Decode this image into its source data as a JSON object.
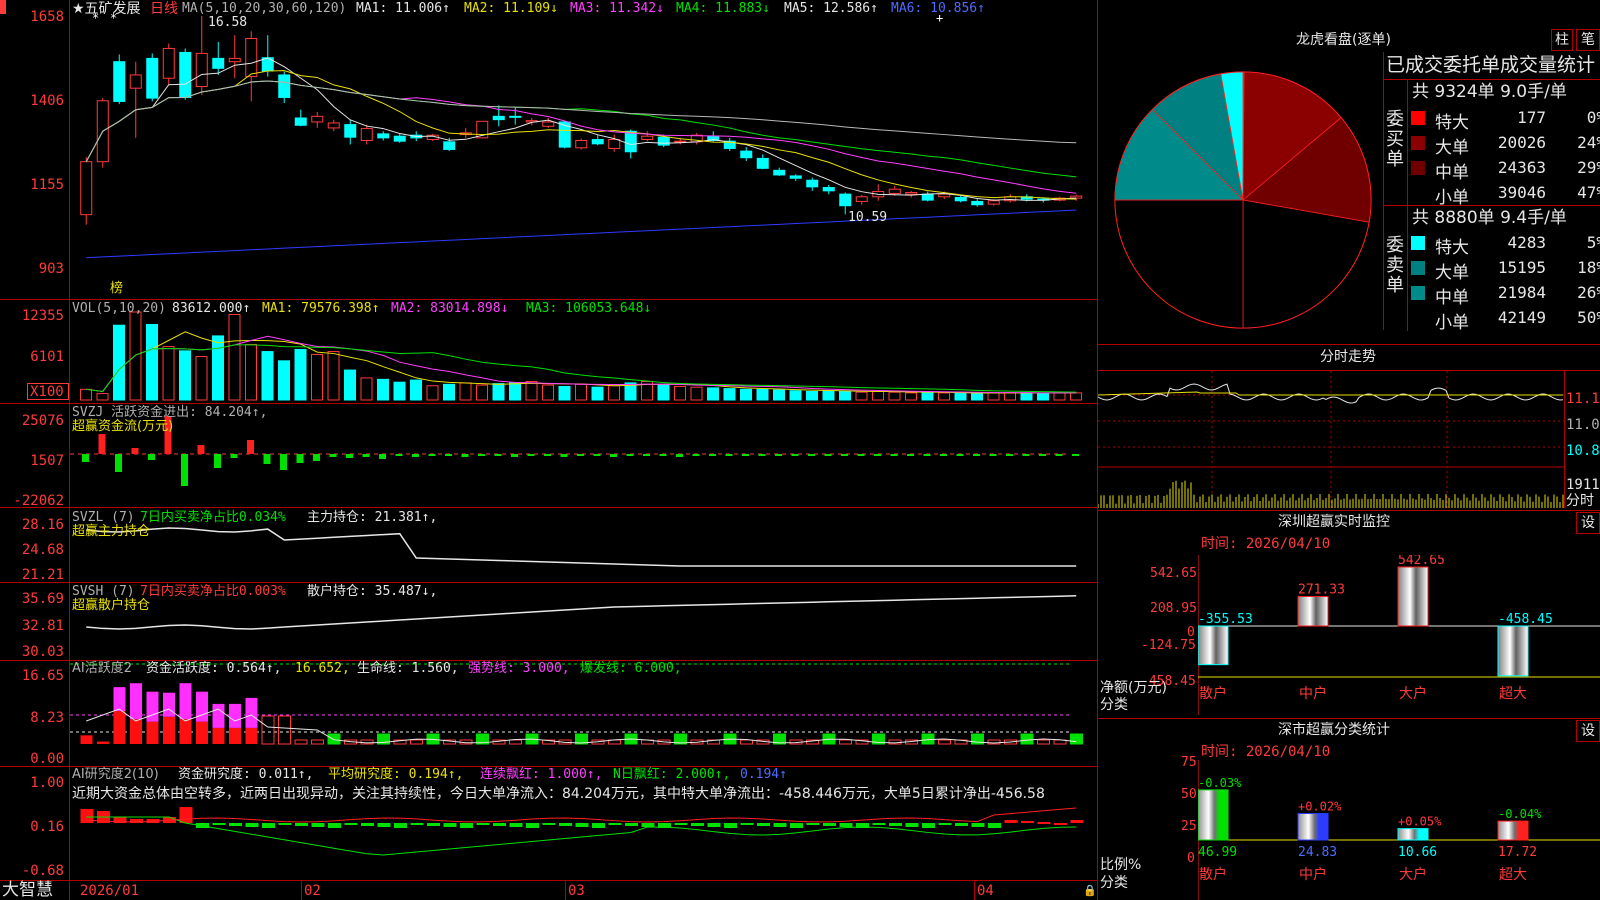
{
  "main_chart": {
    "title": "★五矿发展",
    "period": "日线",
    "ma_label": "MA(5,10,20,30,60,120)",
    "ma1": "MA1: 11.006↑",
    "ma2": "MA2: 11.109↓",
    "ma3": "MA3: 11.342↓",
    "ma4": "MA4: 11.883↓",
    "ma5": "MA5: 12.586↑",
    "ma6": "MA6: 10.856↑",
    "high_label": "16.58",
    "low_label": "10.59",
    "bang_label": "榜",
    "y_ticks": [
      "1658",
      "1406",
      "1155",
      "903"
    ]
  },
  "vol_panel": {
    "label": "VOL(5,10,20)",
    "vol": "83612.000↑",
    "ma1": "MA1: 79576.398↑",
    "ma2": "MA2: 83014.898↓",
    "ma3": "MA3: 106053.648↓",
    "y_ticks": [
      "12355",
      "6101"
    ],
    "unit": "X100"
  },
  "svzj_panel": {
    "line1": "SVZJ  活跃资金进出: 84.204↑,",
    "line2": "超赢资金流(万元)",
    "y_ticks": [
      "25076",
      "1507",
      "-22062"
    ]
  },
  "svzl_panel": {
    "prefix": "SVZL (7)",
    "ratio": "7日内买卖净占比0.034%",
    "hold": "主力持仓: 21.381↑,",
    "line2": "超赢主力持仓",
    "y_ticks": [
      "28.16",
      "24.68",
      "21.21"
    ]
  },
  "svsh_panel": {
    "prefix": "SVSH (7)",
    "ratio": "7日内买卖净占比0.003%",
    "hold": "散户持仓: 35.487↓,",
    "line2": "超赢散户持仓",
    "y_ticks": [
      "35.69",
      "32.81",
      "30.03"
    ]
  },
  "ai_active_panel": {
    "prefix": "AI活跃度2",
    "activity": "资金活跃度: 0.564↑,",
    "val2": "16.652,",
    "life": "生命线: 1.560,",
    "strong": "强势线: 3.000,",
    "burst": "爆发线: 6.000,",
    "y_ticks": [
      "16.65",
      "8.23",
      "0.00"
    ]
  },
  "ai_research_panel": {
    "prefix": "AI研究度2(10)",
    "research": "资金研究度: 0.011↑,",
    "avg": "平均研究度: 0.194↑,",
    "cont": "连续飘红: 1.000↑,",
    "nday": "N日飘红: 2.000↑,",
    "last": "0.194↑",
    "commentary": "近期大资金总体由空转多，近两日出现异动，关注其持续性，今日大单净流入：84.204万元，其中特大单净流出：-458.446万元，大单5日累计净出-456.58",
    "y_ticks": [
      "1.00",
      "0.16",
      "-0.68"
    ]
  },
  "bottom_bar": {
    "brand": "大智慧",
    "dates": [
      "2026/01",
      "02",
      "03",
      "04"
    ]
  },
  "right_panel": {
    "lhb_title": "龙虎看盘(逐单)",
    "btn_zhu": "柱",
    "btn_bi": "笔",
    "stats_title": "已成交委托单成交量统计",
    "buy_header": "共 9324单 9.0手/单",
    "buy_label": "委买单",
    "buy_rows": [
      {
        "name": "特大",
        "value": "177",
        "pct": "0%",
        "color": "#ff0000"
      },
      {
        "name": "大单",
        "value": "20026",
        "pct": "24%",
        "color": "#8b0000"
      },
      {
        "name": "中单",
        "value": "24363",
        "pct": "29%",
        "color": "#700000"
      },
      {
        "name": "小单",
        "value": "39046",
        "pct": "47%",
        "color": "#000000"
      }
    ],
    "sell_header": "共 8880单 9.4手/单",
    "sell_label": "委卖单",
    "sell_rows": [
      {
        "name": "特大",
        "value": "4283",
        "pct": "5%",
        "color": "#00ffff"
      },
      {
        "name": "大单",
        "value": "15195",
        "pct": "18%",
        "color": "#008080"
      },
      {
        "name": "中单",
        "value": "21984",
        "pct": "26%",
        "color": "#008b8b"
      },
      {
        "name": "小单",
        "value": "42149",
        "pct": "50%",
        "color": "#000000"
      }
    ],
    "pie": {
      "slices": [
        {
          "name": "委买特大",
          "pct": 0,
          "color": "#ff0000"
        },
        {
          "name": "委买大单",
          "pct": 24,
          "color": "#8b0000"
        },
        {
          "name": "委买中单",
          "pct": 29,
          "color": "#700000"
        },
        {
          "name": "委买小单",
          "pct": 47,
          "color": "#000000"
        },
        {
          "name": "委卖小单",
          "pct": 50,
          "color": "#000000"
        },
        {
          "name": "委卖中单",
          "pct": 26,
          "color": "#008b8b"
        },
        {
          "name": "委卖大单",
          "pct": 18,
          "color": "#008080"
        },
        {
          "name": "委卖特大",
          "pct": 5,
          "color": "#00ffff"
        }
      ]
    },
    "fenshi_title": "分时走势",
    "fenshi_ticks": [
      "11.1",
      "11.0",
      "10.8"
    ],
    "fenshi_vol": "1911",
    "fenshi_vol_label": "分时",
    "sz_monitor_title": "深圳超赢实时监控",
    "sz_btn": "设",
    "sz_time": "时间: 2026/04/10",
    "sz_y_ticks": [
      "542.65",
      "208.95",
      "0",
      "-124.75",
      "-458.45"
    ],
    "sz_ylabel": "净额(万元)",
    "sz_xlabel": "分类",
    "sz_bars": [
      {
        "name": "散户",
        "value": -355.53,
        "label": "-355.53"
      },
      {
        "name": "中户",
        "value": 271.33,
        "label": "271.33"
      },
      {
        "name": "大户",
        "value": 542.65,
        "label": "542.65"
      },
      {
        "name": "超大",
        "value": -458.45,
        "label": "-458.45"
      }
    ],
    "cls_title": "深市超赢分类统计",
    "cls_btn": "设",
    "cls_time": "时间: 2026/04/10",
    "cls_y_ticks": [
      "75",
      "50",
      "25",
      "0"
    ],
    "cls_ylabel": "比例%",
    "cls_xlabel": "分类",
    "cls_bars": [
      {
        "name": "散户",
        "value": 46.99,
        "label": "46.99",
        "change": "-0.03%",
        "color": "#00e000"
      },
      {
        "name": "中户",
        "value": 24.83,
        "label": "24.83",
        "change": "+0.02%",
        "color": "#2b3cff"
      },
      {
        "name": "大户",
        "value": 10.66,
        "label": "10.66",
        "change": "+0.05%",
        "color": "#00ffff"
      },
      {
        "name": "超大",
        "value": 17.72,
        "label": "17.72",
        "change": "-0.04%",
        "color": "#ff2020"
      }
    ]
  },
  "chart_data": {
    "type": "candlestick",
    "ylim": [
      903,
      1658
    ],
    "candles": [
      [
        1058,
        1218,
        1028,
        1232
      ],
      [
        1218,
        1402,
        1200,
        1410
      ],
      [
        1520,
        1400,
        1392,
        1542
      ],
      [
        1440,
        1480,
        1290,
        1520
      ],
      [
        1530,
        1410,
        1400,
        1545
      ],
      [
        1470,
        1560,
        1450,
        1575
      ],
      [
        1548,
        1412,
        1405,
        1560
      ],
      [
        1445,
        1545,
        1420,
        1658
      ],
      [
        1530,
        1500,
        1480,
        1580
      ],
      [
        1520,
        1530,
        1470,
        1600
      ],
      [
        1475,
        1590,
        1400,
        1612
      ],
      [
        1532,
        1492,
        1475,
        1600
      ],
      [
        1480,
        1412,
        1395,
        1490
      ],
      [
        1350,
        1328,
        1325,
        1375
      ],
      [
        1338,
        1355,
        1320,
        1368
      ],
      [
        1320,
        1335,
        1310,
        1345
      ],
      [
        1330,
        1292,
        1270,
        1345
      ],
      [
        1282,
        1318,
        1270,
        1330
      ],
      [
        1302,
        1290,
        1282,
        1310
      ],
      [
        1295,
        1280,
        1275,
        1302
      ],
      [
        1298,
        1290,
        1280,
        1310
      ],
      [
        1285,
        1298,
        1280,
        1302
      ],
      [
        1278,
        1255,
        1250,
        1290
      ],
      [
        1300,
        1305,
        1290,
        1320
      ],
      [
        1290,
        1340,
        1290,
        1340
      ],
      [
        1355,
        1345,
        1325,
        1388
      ],
      [
        1355,
        1352,
        1330,
        1383
      ],
      [
        1338,
        1342,
        1328,
        1350
      ],
      [
        1325,
        1338,
        1320,
        1350
      ],
      [
        1338,
        1262,
        1258,
        1342
      ],
      [
        1260,
        1282,
        1255,
        1288
      ],
      [
        1285,
        1272,
        1268,
        1298
      ],
      [
        1258,
        1285,
        1248,
        1300
      ],
      [
        1310,
        1248,
        1228,
        1315
      ],
      [
        1285,
        1295,
        1280,
        1310
      ],
      [
        1292,
        1268,
        1262,
        1300
      ],
      [
        1280,
        1280,
        1270,
        1290
      ],
      [
        1278,
        1298,
        1270,
        1305
      ],
      [
        1295,
        1282,
        1278,
        1310
      ],
      [
        1280,
        1258,
        1250,
        1290
      ],
      [
        1250,
        1230,
        1220,
        1262
      ],
      [
        1228,
        1198,
        1195,
        1240
      ],
      [
        1192,
        1178,
        1175,
        1200
      ],
      [
        1175,
        1168,
        1160,
        1180
      ],
      [
        1162,
        1142,
        1130,
        1170
      ],
      [
        1140,
        1130,
        1120,
        1148
      ],
      [
        1120,
        1085,
        1059,
        1125
      ],
      [
        1098,
        1112,
        1088,
        1118
      ],
      [
        1112,
        1128,
        1100,
        1150
      ],
      [
        1122,
        1135,
        1115,
        1145
      ],
      [
        1120,
        1125,
        1110,
        1130
      ],
      [
        1120,
        1102,
        1098,
        1128
      ],
      [
        1112,
        1120,
        1105,
        1128
      ],
      [
        1110,
        1100,
        1095,
        1118
      ],
      [
        1098,
        1088,
        1082,
        1105
      ],
      [
        1090,
        1100,
        1085,
        1105
      ],
      [
        1100,
        1112,
        1095,
        1120
      ],
      [
        1112,
        1105,
        1098,
        1120
      ],
      [
        1105,
        1102,
        1095,
        1110
      ],
      [
        1102,
        1108,
        1098,
        1112
      ],
      [
        1108,
        1114,
        1100,
        1118
      ]
    ],
    "vol": [
      1500,
      900,
      10500,
      12355,
      10600,
      7500,
      6900,
      6100,
      9000,
      12000,
      7800,
      6800,
      5500,
      7100,
      6400,
      6800,
      4200,
      3100,
      2900,
      2500,
      2800,
      2000,
      2200,
      2400,
      2100,
      2300,
      2400,
      2600,
      2100,
      1900,
      2200,
      1800,
      2000,
      2400,
      2600,
      2200,
      1900,
      1800,
      1700,
      1600,
      1500,
      1500,
      1400,
      1300,
      1200,
      1300,
      1200,
      1100,
      1200,
      1100,
      1000,
      1100,
      1000,
      950,
      900,
      1000,
      1050,
      1000,
      950,
      1000,
      1000
    ]
  }
}
